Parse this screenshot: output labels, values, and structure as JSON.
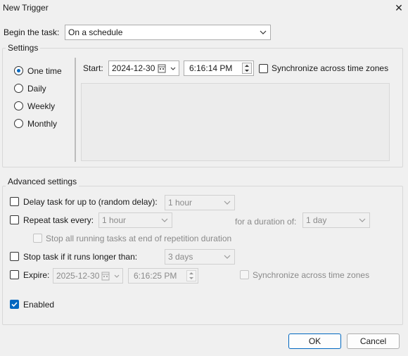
{
  "window": {
    "title": "New Trigger",
    "close_glyph": "✕"
  },
  "begin": {
    "label": "Begin the task:",
    "value": "On a schedule"
  },
  "settings": {
    "title": "Settings",
    "options": [
      "One time",
      "Daily",
      "Weekly",
      "Monthly"
    ],
    "selected": "One time",
    "start_label": "Start:",
    "start_date": "2024-12-30",
    "start_time": "6:16:14 PM",
    "sync_label": "Synchronize across time zones",
    "sync_checked": false
  },
  "advanced": {
    "title": "Advanced settings",
    "delay_label": "Delay task for up to (random delay):",
    "delay_value": "1 hour",
    "repeat_label": "Repeat task every:",
    "repeat_value": "1 hour",
    "duration_label": "for a duration of:",
    "duration_value": "1 day",
    "stop_all_label": "Stop all running tasks at end of repetition duration",
    "stop_longer_label": "Stop task if it runs longer than:",
    "stop_longer_value": "3 days",
    "expire_label": "Expire:",
    "expire_date": "2025-12-30",
    "expire_time": "6:16:25 PM",
    "expire_sync_label": "Synchronize across time zones",
    "enabled_label": "Enabled",
    "enabled_checked": true
  },
  "buttons": {
    "ok": "OK",
    "cancel": "Cancel"
  },
  "colors": {
    "accent": "#0067c0",
    "background": "#f0f0f0"
  }
}
